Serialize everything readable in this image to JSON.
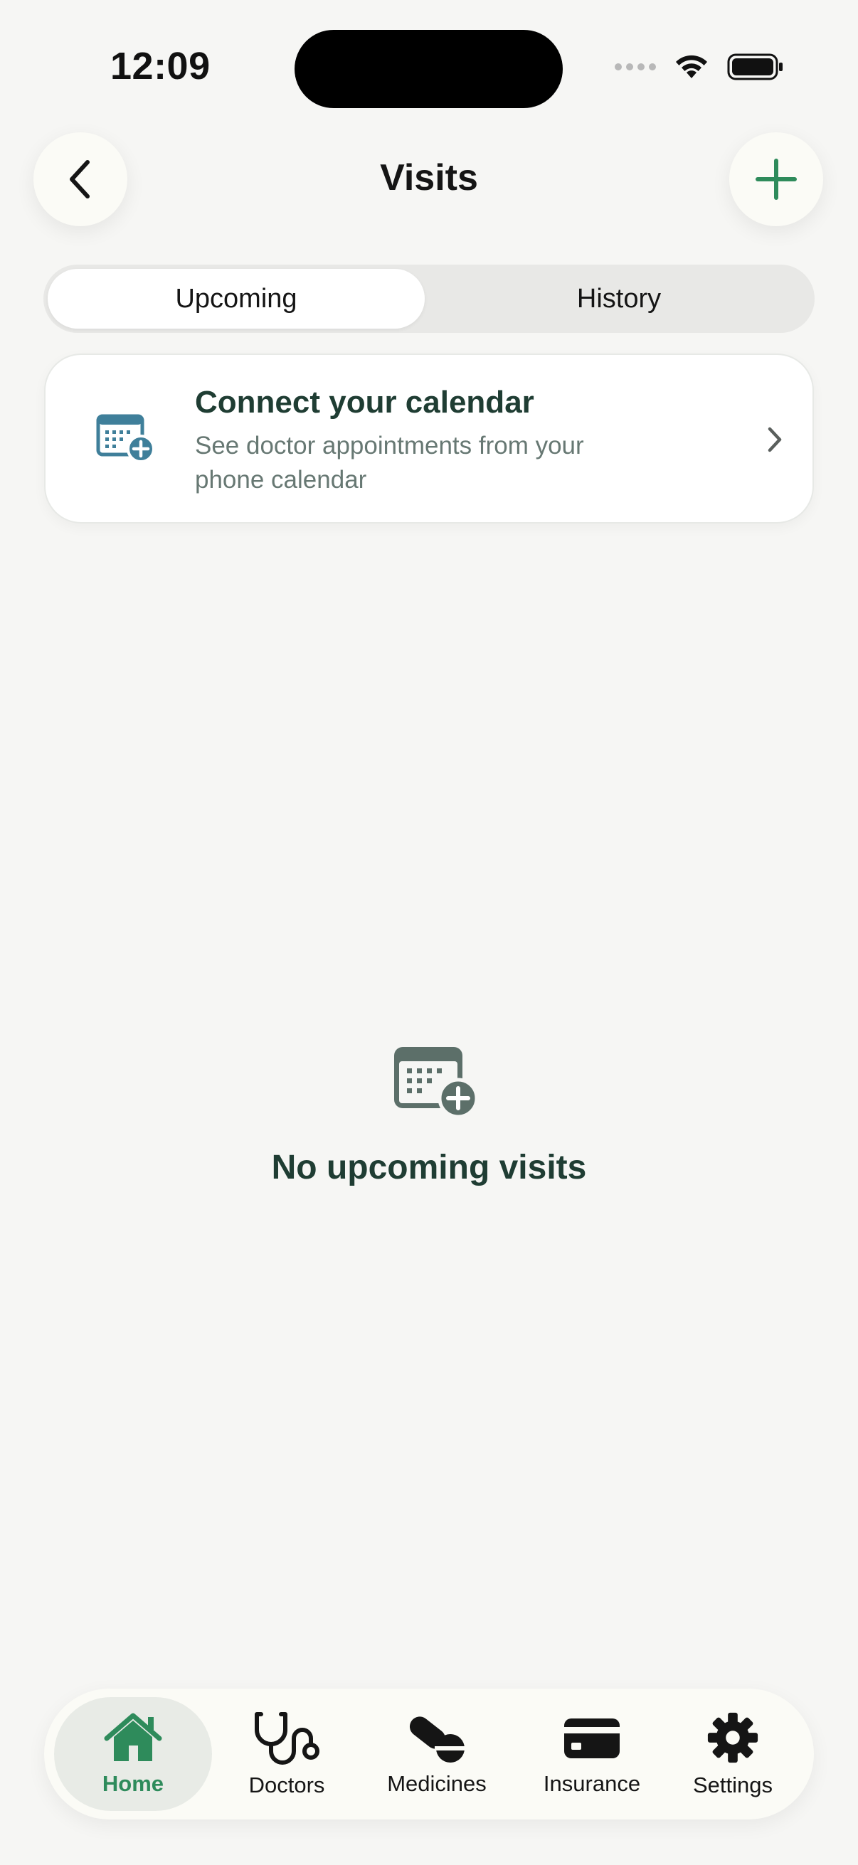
{
  "status_bar": {
    "time": "12:09"
  },
  "header": {
    "title": "Visits",
    "back_icon": "chevron-left-icon",
    "add_icon": "plus-icon"
  },
  "segments": [
    {
      "label": "Upcoming",
      "active": true
    },
    {
      "label": "History",
      "active": false
    }
  ],
  "calendar_card": {
    "title": "Connect your calendar",
    "subtitle": "See doctor appointments from your phone calendar",
    "icon": "calendar-plus-icon"
  },
  "empty_state": {
    "message": "No upcoming visits",
    "icon": "calendar-plus-icon"
  },
  "tab_bar": {
    "items": [
      {
        "label": "Home",
        "icon": "house-icon",
        "active": true
      },
      {
        "label": "Doctors",
        "icon": "stethoscope-icon",
        "active": false
      },
      {
        "label": "Medicines",
        "icon": "pills-icon",
        "active": false
      },
      {
        "label": "Insurance",
        "icon": "card-icon",
        "active": false
      },
      {
        "label": "Settings",
        "icon": "gear-icon",
        "active": false
      }
    ]
  },
  "colors": {
    "accent": "#2e8b5b",
    "card_icon": "#3f7f9a",
    "empty_icon": "#5c6f69",
    "heading": "#1f3d33",
    "background": "#f6f6f4"
  }
}
